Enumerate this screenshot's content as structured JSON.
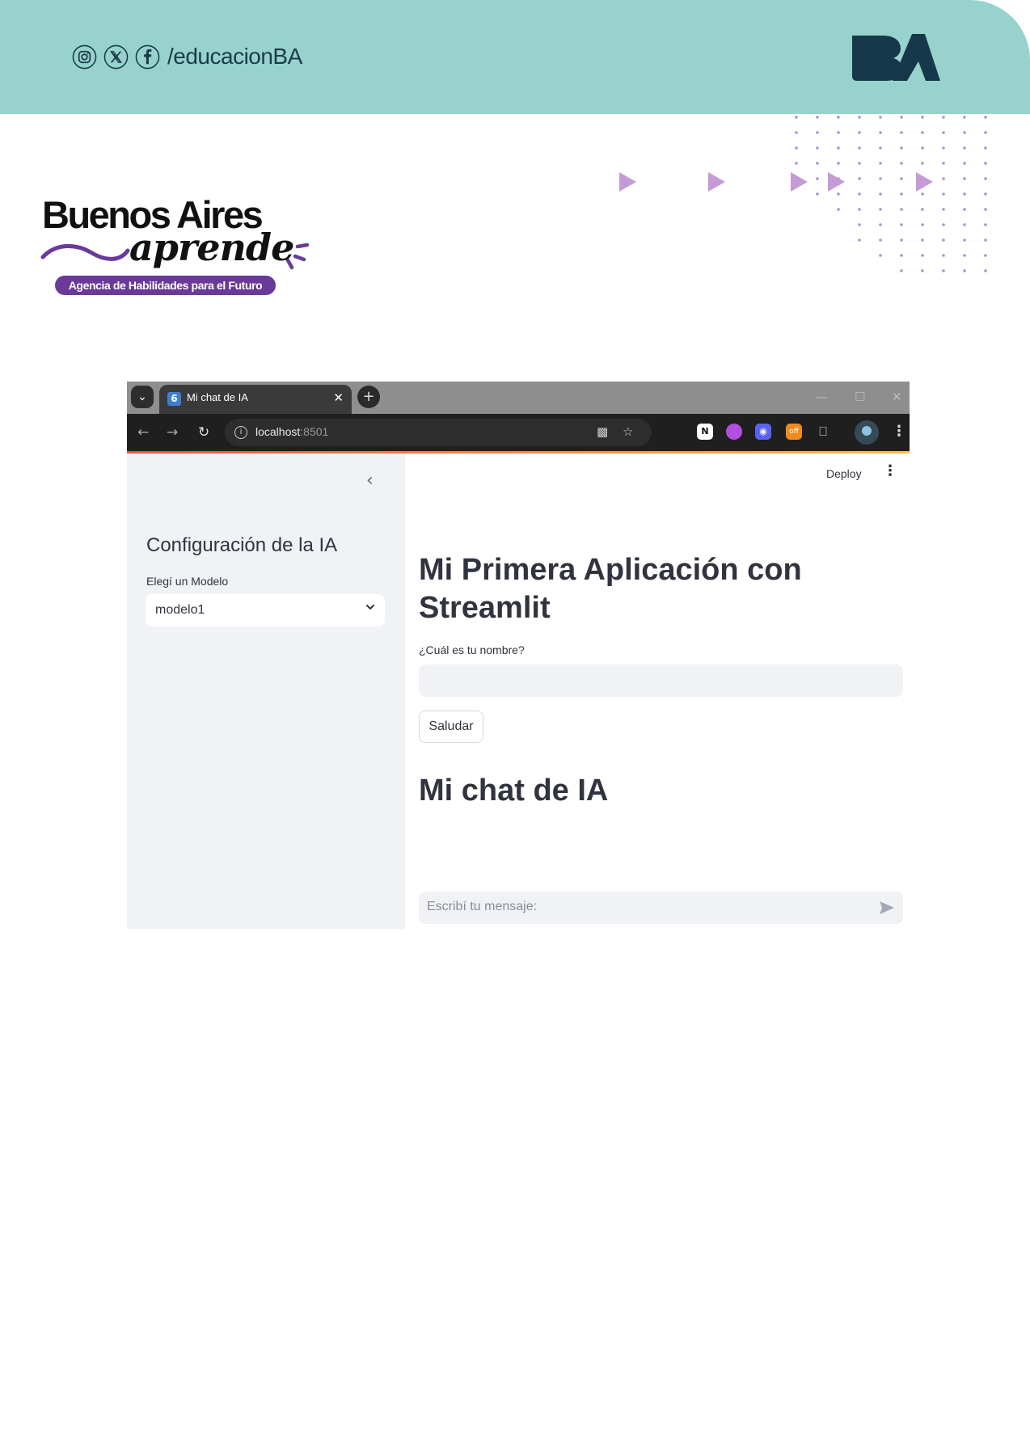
{
  "header": {
    "social_icons": [
      "instagram-icon",
      "x-icon",
      "facebook-icon"
    ],
    "handle": "/educacionBA",
    "logo_text": "BA",
    "band_color": "#97d3cc",
    "text_color": "#1c3a48"
  },
  "brand": {
    "title": "Buenos Aires",
    "script": "aprende",
    "tagline": "Agencia de Habilidades para el Futuro",
    "accent_color": "#6a3a99"
  },
  "browser": {
    "tab_title": "Mi chat de IA",
    "tab_favicon": "6",
    "url_host": "localhost",
    "url_port": ":8501"
  },
  "app": {
    "sidebar": {
      "title": "Configuración de la IA",
      "select_label": "Elegí un Modelo",
      "select_value": "modelo1"
    },
    "deploy_label": "Deploy",
    "title": "Mi Primera Aplicación con Streamlit",
    "name_label": "¿Cuál es tu nombre?",
    "name_value": "",
    "greet_button": "Saludar",
    "chat_title": "Mi chat de IA",
    "chat_placeholder": "Escribí tu mensaje:"
  }
}
